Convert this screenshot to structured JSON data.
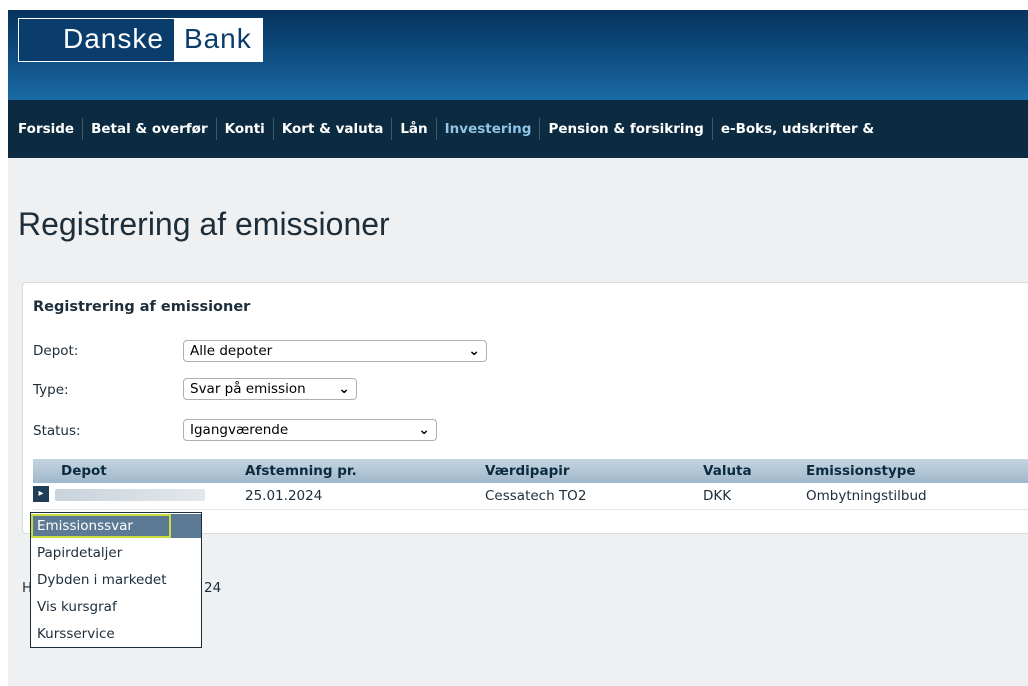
{
  "header": {
    "logo_left": "Danske",
    "logo_right": "Bank"
  },
  "nav": {
    "items": [
      "Forside",
      "Betal & overfør",
      "Konti",
      "Kort & valuta",
      "Lån",
      "Investering",
      "Pension & forsikring",
      "e-Boks, udskrifter &"
    ],
    "active": "Investering"
  },
  "page": {
    "title": "Registrering af emissioner"
  },
  "panel": {
    "title": "Registrering af emissioner",
    "filters": {
      "depot_label": "Depot:",
      "depot_value": "Alle depoter",
      "type_label": "Type:",
      "type_value": "Svar på emission",
      "status_label": "Status:",
      "status_value": "Igangværende"
    },
    "table": {
      "headers": [
        "Depot",
        "Afstemning pr.",
        "Værdipapir",
        "Valuta",
        "Emissionstype"
      ],
      "rows": [
        {
          "depot": "",
          "afstemning": "25.01.2024",
          "vaerdipapir": "Cessatech TO2",
          "valuta": "DKK",
          "emissionstype": "Ombytningstilbud"
        }
      ]
    }
  },
  "footer_hint": {
    "left": "H",
    "right": "24"
  },
  "menu": {
    "items": [
      "Emissionssvar",
      "Papirdetaljer",
      "Dybden i markedet",
      "Vis kursgraf",
      "Kursservice"
    ],
    "highlighted": "Emissionssvar"
  },
  "colors": {
    "header_dark": "#08345e",
    "nav_bg": "#0c2b40",
    "active_nav": "#8fc4e6",
    "highlight_border": "#c9dd43"
  }
}
